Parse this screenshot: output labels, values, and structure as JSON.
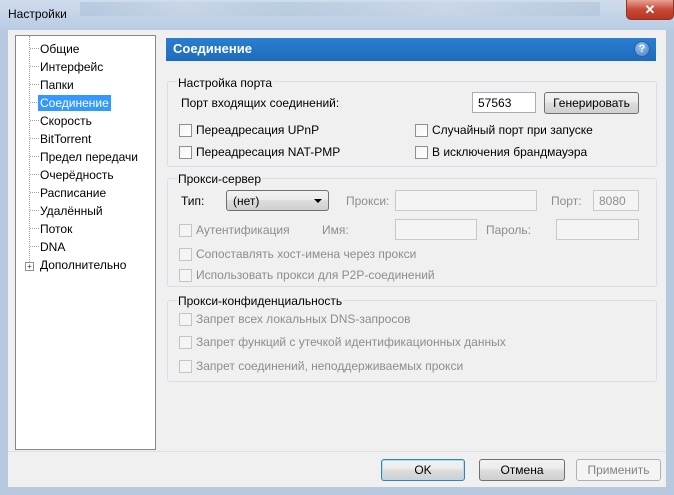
{
  "window": {
    "title": "Настройки",
    "close_symbol": "✕"
  },
  "sidebar": {
    "items": [
      {
        "label": "Общие"
      },
      {
        "label": "Интерфейс"
      },
      {
        "label": "Папки"
      },
      {
        "label": "Соединение",
        "selected": true
      },
      {
        "label": "Скорость"
      },
      {
        "label": "BitTorrent"
      },
      {
        "label": "Предел передачи"
      },
      {
        "label": "Очерёдность"
      },
      {
        "label": "Расписание"
      },
      {
        "label": "Удалённый"
      },
      {
        "label": "Поток"
      },
      {
        "label": "DNA"
      },
      {
        "label": "Дополнительно",
        "expandable": true
      }
    ],
    "expander_symbol": "+"
  },
  "panel": {
    "title": "Соединение",
    "help_symbol": "?",
    "accent_color": "#1e6bbd"
  },
  "port_settings": {
    "group_title": "Настройка порта",
    "port_label": "Порт входящих соединений:",
    "port_value": "57563",
    "generate_button": "Генерировать",
    "upnp_label": "Переадресация UPnP",
    "natpmp_label": "Переадресация NAT-PMP",
    "random_port_label": "Случайный порт при запуске",
    "firewall_label": "В исключения брандмауэра"
  },
  "proxy": {
    "group_title": "Прокси-сервер",
    "type_label": "Тип:",
    "type_value": "(нет)",
    "proxy_label": "Прокси:",
    "proxy_value": "",
    "port_label": "Порт:",
    "port_value": "8080",
    "auth_label": "Аутентификация",
    "username_label": "Имя:",
    "username_value": "",
    "password_label": "Пароль:",
    "password_value": "",
    "resolve_hostnames_label": "Сопоставлять хост-имена через прокси",
    "p2p_label": "Использовать прокси для P2P-соединений"
  },
  "privacy": {
    "group_title": "Прокси-конфиденциальность",
    "dns_label": "Запрет всех локальных DNS-запросов",
    "leak_label": "Запрет функций с утечкой идентификационных данных",
    "unsupported_label": "Запрет соединений, неподдерживаемых прокси"
  },
  "footer": {
    "ok": "OK",
    "cancel": "Отмена",
    "apply": "Применить"
  }
}
